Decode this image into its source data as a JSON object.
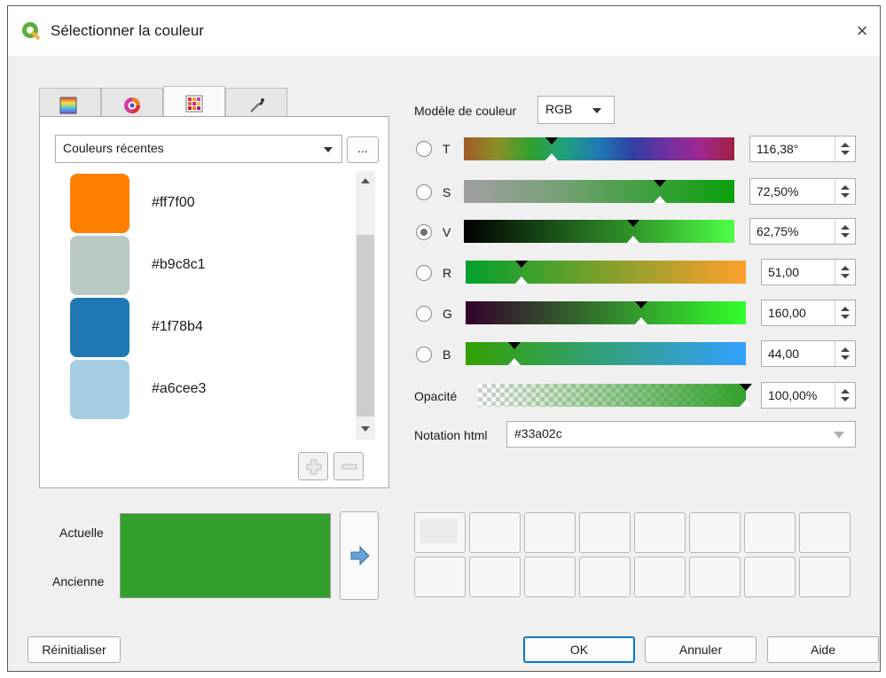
{
  "window": {
    "title": "Sélectionner la couleur",
    "close_symbol": "×"
  },
  "tabs": [
    {
      "icon": "color-ramp-icon"
    },
    {
      "icon": "color-wheel-icon"
    },
    {
      "icon": "color-swatches-icon",
      "active": true
    },
    {
      "icon": "eyedropper-icon"
    }
  ],
  "swatch_panel": {
    "source_combo": "Couleurs récentes",
    "more_button": "...",
    "swatches": [
      {
        "hex": "#ff7f00",
        "label": "#ff7f00"
      },
      {
        "hex": "#b9c8c1",
        "label": "#b9c8c1"
      },
      {
        "hex": "#1f78b4",
        "label": "#1f78b4"
      },
      {
        "hex": "#a6cee3",
        "label": "#a6cee3"
      }
    ]
  },
  "color_model": {
    "label": "Modèle de couleur",
    "value": "RGB"
  },
  "channels": [
    {
      "letter": "T",
      "value": "116,38°",
      "level": 0.323,
      "selected": false
    },
    {
      "letter": "S",
      "value": "72,50%",
      "level": 0.725,
      "selected": false
    },
    {
      "letter": "V",
      "value": "62,75%",
      "level": 0.6275,
      "selected": true
    },
    {
      "letter": "R",
      "value": "51,00",
      "level": 0.2,
      "selected": false
    },
    {
      "letter": "G",
      "value": "160,00",
      "level": 0.627,
      "selected": false
    },
    {
      "letter": "B",
      "value": "44,00",
      "level": 0.1725,
      "selected": false
    }
  ],
  "opacity": {
    "label": "Opacité",
    "value": "100,00%",
    "level": 1.0
  },
  "html_notation": {
    "label": "Notation html",
    "value": "#33a02c"
  },
  "preview": {
    "current_label": "Actuelle",
    "old_label": "Ancienne",
    "current_color": "#33a02c",
    "old_color": "#33a02c"
  },
  "buttons": {
    "reset": "Réinitialiser",
    "ok": "OK",
    "cancel": "Annuler",
    "help": "Aide"
  },
  "colors": {
    "app_icon": "#5fae3a",
    "accent_border": "#0078d7"
  }
}
